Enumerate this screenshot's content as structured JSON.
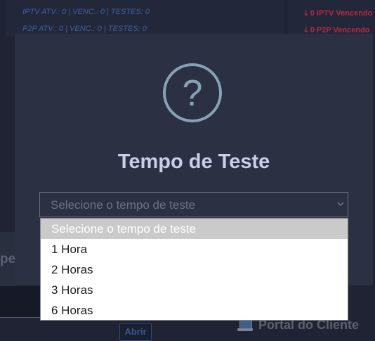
{
  "background": {
    "stats": [
      "IPTV ATV.: 0 | VENC.: 0 | TESTES: 0",
      "P2P ATV.: 0 | VENC.: 0 | TESTES: 0"
    ],
    "alerts": [
      "0 IPTV Vencendo",
      "0 P2P Vencendo"
    ],
    "side_text": "pes",
    "abrir_button": "Abrir",
    "portal_label": "Portal do Cliente"
  },
  "modal": {
    "icon": "question-circle-icon",
    "icon_glyph": "?",
    "title": "Tempo de Teste",
    "select": {
      "placeholder": "Selecione o tempo de teste",
      "options": [
        "Selecione o tempo de teste",
        "1 Hora",
        "2 Horas",
        "3 Horas",
        "6 Horas"
      ],
      "highlighted_index": 0
    }
  },
  "colors": {
    "page_bg": "#1f2333",
    "modal_bg": "#2b3042",
    "title": "#c9cee9",
    "icon": "#86a2b4",
    "alert": "#b8283a",
    "stat": "#3f5e99"
  }
}
